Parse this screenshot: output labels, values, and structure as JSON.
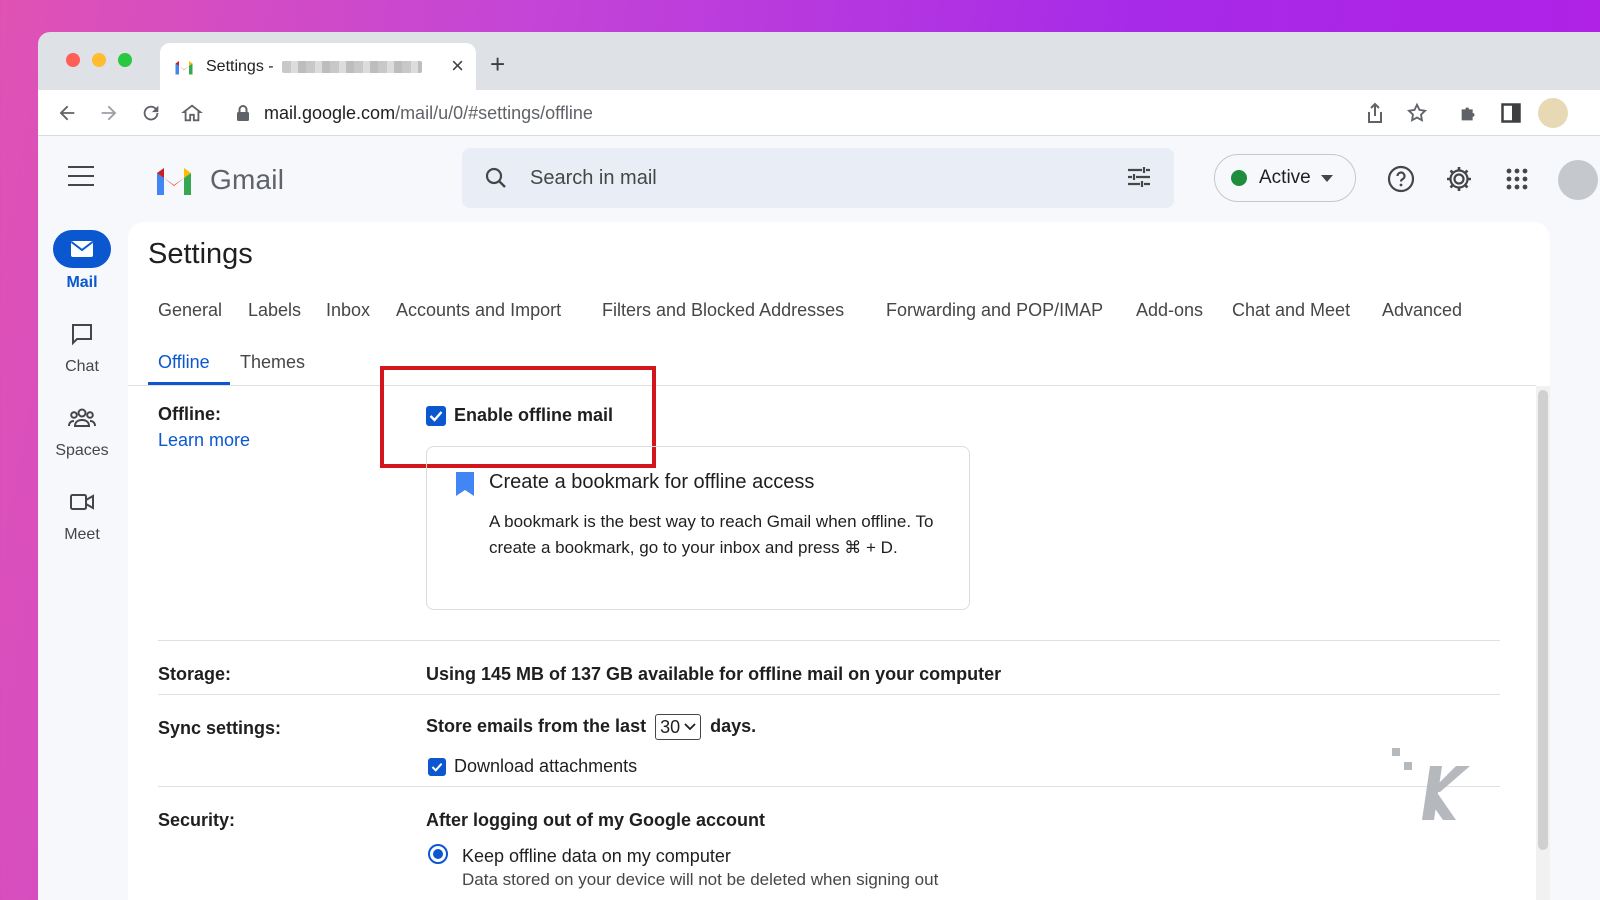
{
  "browser": {
    "tab_title": "Settings -",
    "new_tab_symbol": "+",
    "close_symbol": "×",
    "url_host": "mail.google.com",
    "url_path": "/mail/u/0/#settings/offline"
  },
  "header": {
    "app_name": "Gmail",
    "search_placeholder": "Search in mail",
    "status_label": "Active"
  },
  "rail": {
    "mail": "Mail",
    "chat": "Chat",
    "spaces": "Spaces",
    "meet": "Meet"
  },
  "settings": {
    "title": "Settings",
    "tabs": {
      "general": "General",
      "labels": "Labels",
      "inbox": "Inbox",
      "accounts": "Accounts and Import",
      "filters": "Filters and Blocked Addresses",
      "forwarding": "Forwarding and POP/IMAP",
      "addons": "Add-ons",
      "chat": "Chat and Meet",
      "advanced": "Advanced",
      "offline": "Offline",
      "themes": "Themes"
    },
    "offline": {
      "label": "Offline:",
      "learn_more": "Learn more",
      "enable_label": "Enable offline mail",
      "enable_checked": true,
      "bookmark_title": "Create a bookmark for offline access",
      "bookmark_body": "A bookmark is the best way to reach Gmail when offline. To create a bookmark, go to your inbox and press ⌘ + D."
    },
    "storage": {
      "label": "Storage:",
      "value": "Using 145 MB of 137 GB available for offline mail on your computer"
    },
    "sync": {
      "label": "Sync settings:",
      "prefix": "Store emails from the last",
      "days_value": "30",
      "suffix": "days.",
      "attachments_label": "Download attachments",
      "attachments_checked": true
    },
    "security": {
      "label": "Security:",
      "heading": "After logging out of my Google account",
      "option_keep": "Keep offline data on my computer",
      "option_keep_sub": "Data stored on your device will not be deleted when signing out"
    }
  },
  "colors": {
    "accent": "#0b57d0",
    "highlight": "#d3161c",
    "status_green": "#1e8e3e"
  }
}
